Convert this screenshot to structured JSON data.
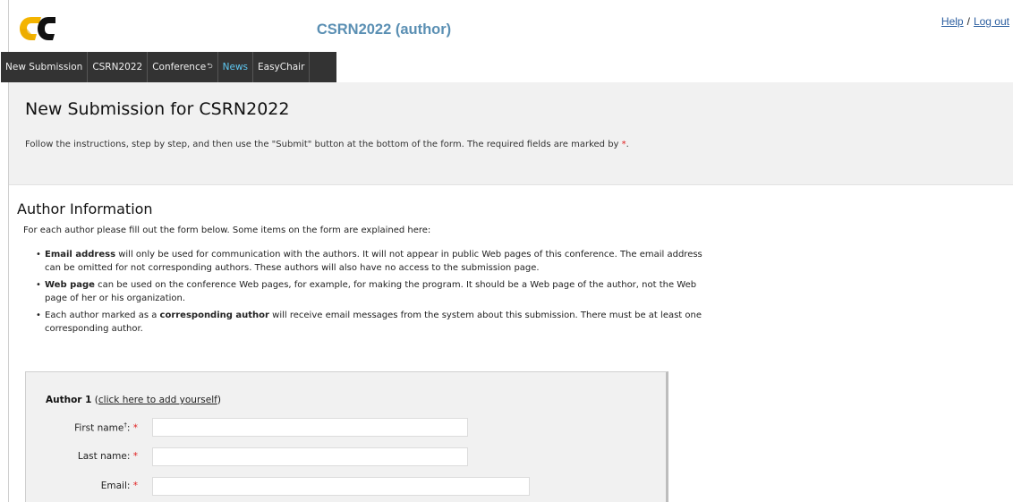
{
  "header": {
    "site_title": "CSRN2022 (author)",
    "help_label": "Help",
    "separator": "/",
    "logout_label": "Log out",
    "brand_colors": {
      "logo_left": "#f4b400",
      "logo_right": "#e8a900",
      "title": "#5a8fb3"
    }
  },
  "nav": {
    "items": [
      {
        "label": "New Submission"
      },
      {
        "label": "CSRN2022"
      },
      {
        "label": "Conference",
        "sup": "⮌"
      },
      {
        "label": "News"
      },
      {
        "label": "EasyChair"
      }
    ],
    "active_color": "#5ec8f2",
    "bg_color": "#333333"
  },
  "intro": {
    "title": "New Submission for CSRN2022",
    "text_before": "Follow the instructions, step by step, and then use the \"Submit\" button at the bottom of the form. The required fields are marked by ",
    "required_mark": "*",
    "text_after": "."
  },
  "author_info": {
    "heading": "Author Information",
    "lead": "For each author please fill out the form below. Some items on the form are explained here:",
    "bullets": [
      {
        "bold": "Email address",
        "text": " will only be used for communication with the authors. It will not appear in public Web pages of this conference. The email address can be omitted for not corresponding authors. These authors will also have no access to the submission page."
      },
      {
        "bold": "Web page",
        "text": " can be used on the conference Web pages, for example, for making the program. It should be a Web page of the author, not the Web page of her or his organization."
      },
      {
        "pre": "Each author marked as a ",
        "bold": "corresponding author",
        "text": " will receive email messages from the system about this submission. There must be at least one corresponding author."
      }
    ]
  },
  "author_form": {
    "title": "Author 1",
    "add_yourself_link": "click here to add yourself",
    "fields": [
      {
        "label": "First name",
        "sup": "†",
        "value": "",
        "required_mark": "*"
      },
      {
        "label": "Last name:",
        "value": "",
        "required_mark": "*"
      },
      {
        "label": "Email:",
        "value": "",
        "required_mark": "*"
      }
    ]
  }
}
